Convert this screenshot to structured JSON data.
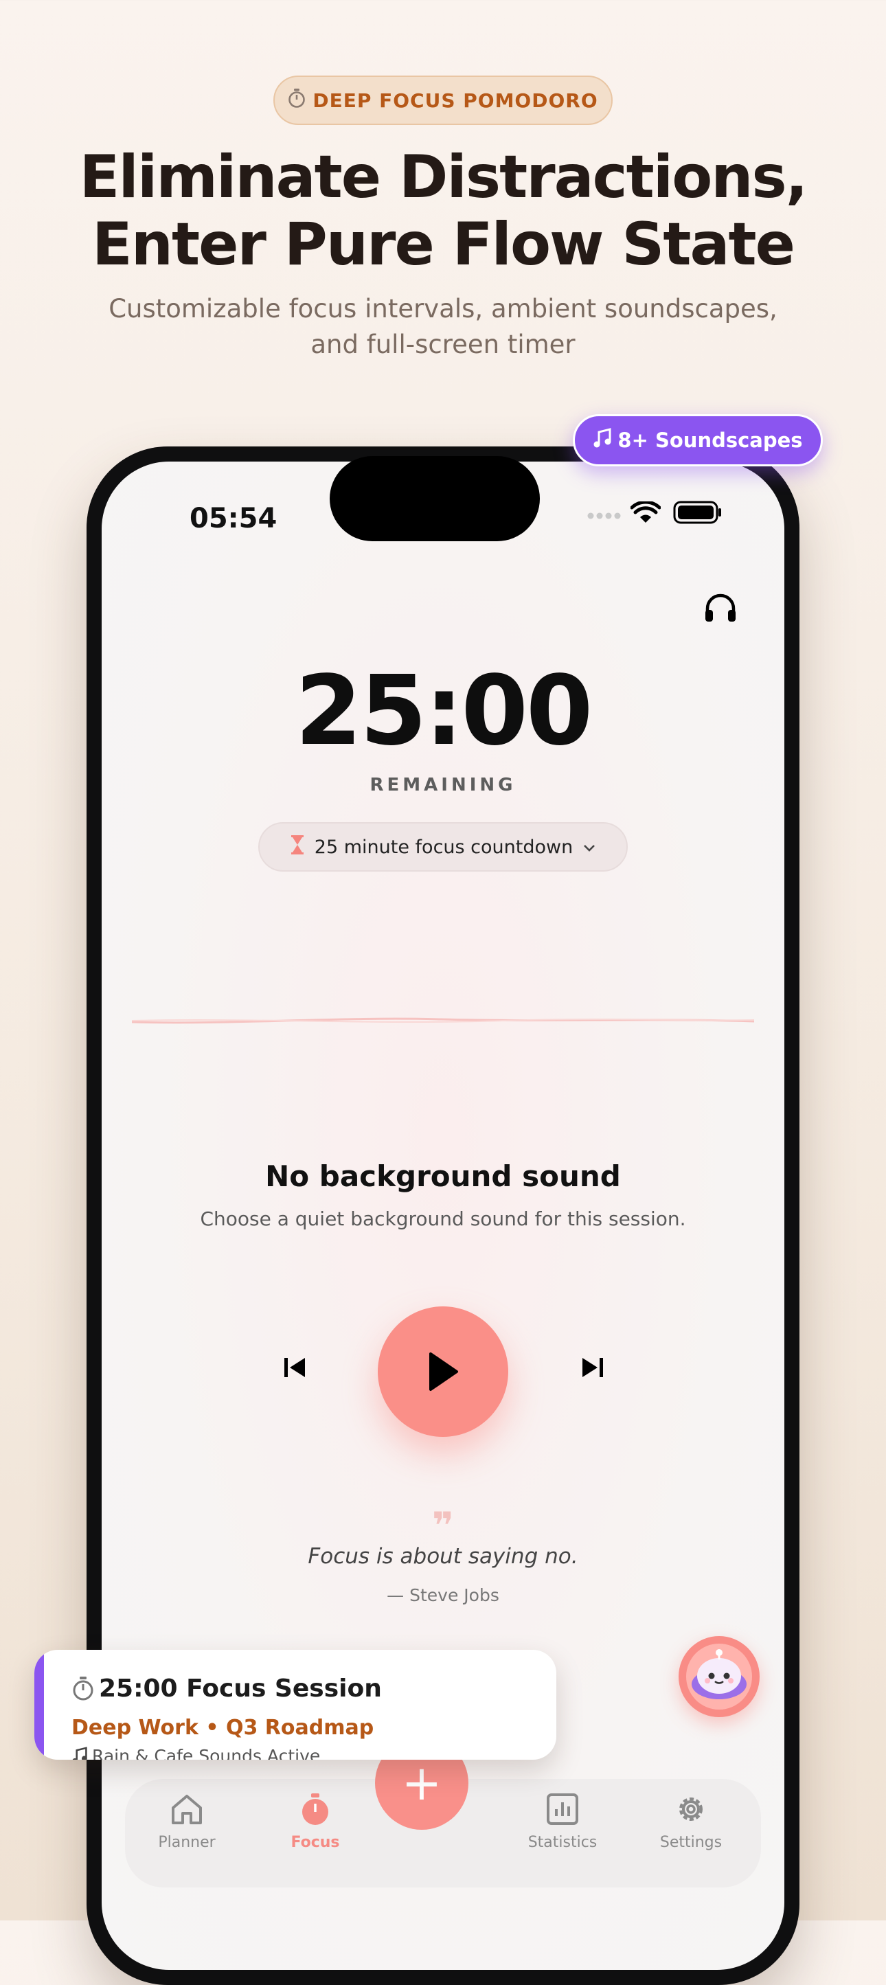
{
  "badge": {
    "icon": "stopwatch-icon",
    "label": "DEEP FOCUS POMODORO"
  },
  "headline": {
    "line1": "Eliminate Distractions,",
    "line2": "Enter Pure Flow State"
  },
  "subheadline": {
    "line1": "Customizable focus intervals, ambient soundscapes,",
    "line2": "and full-screen timer"
  },
  "floating_pill": {
    "icon": "music-note-icon",
    "label": "8+ Soundscapes"
  },
  "status_bar": {
    "time": "05:54"
  },
  "timer": {
    "value": "25:00",
    "label": "REMAINING",
    "mode_selector": "25 minute focus countdown"
  },
  "sound": {
    "title": "No background sound",
    "description": "Choose a quiet background sound for this session."
  },
  "quote": {
    "mark": "❞",
    "text": "Focus is about saying no.",
    "author": "— Steve Jobs"
  },
  "tabs": [
    {
      "label": "Planner",
      "icon": "home-icon",
      "active": false
    },
    {
      "label": "Focus",
      "icon": "stopwatch-icon",
      "active": true
    },
    {
      "label": "Statistics",
      "icon": "chart-icon",
      "active": false
    },
    {
      "label": "Settings",
      "icon": "gear-icon",
      "active": false
    }
  ],
  "fab": {
    "label": "+"
  },
  "session_card": {
    "title": "25:00 Focus Session",
    "subtitle": "Deep Work • Q3 Roadmap",
    "note": "Rain & Cafe Sounds Active"
  },
  "colors": {
    "accent_coral": "#fa8f88",
    "accent_purple": "#8b55f0",
    "accent_orange": "#b65817"
  }
}
